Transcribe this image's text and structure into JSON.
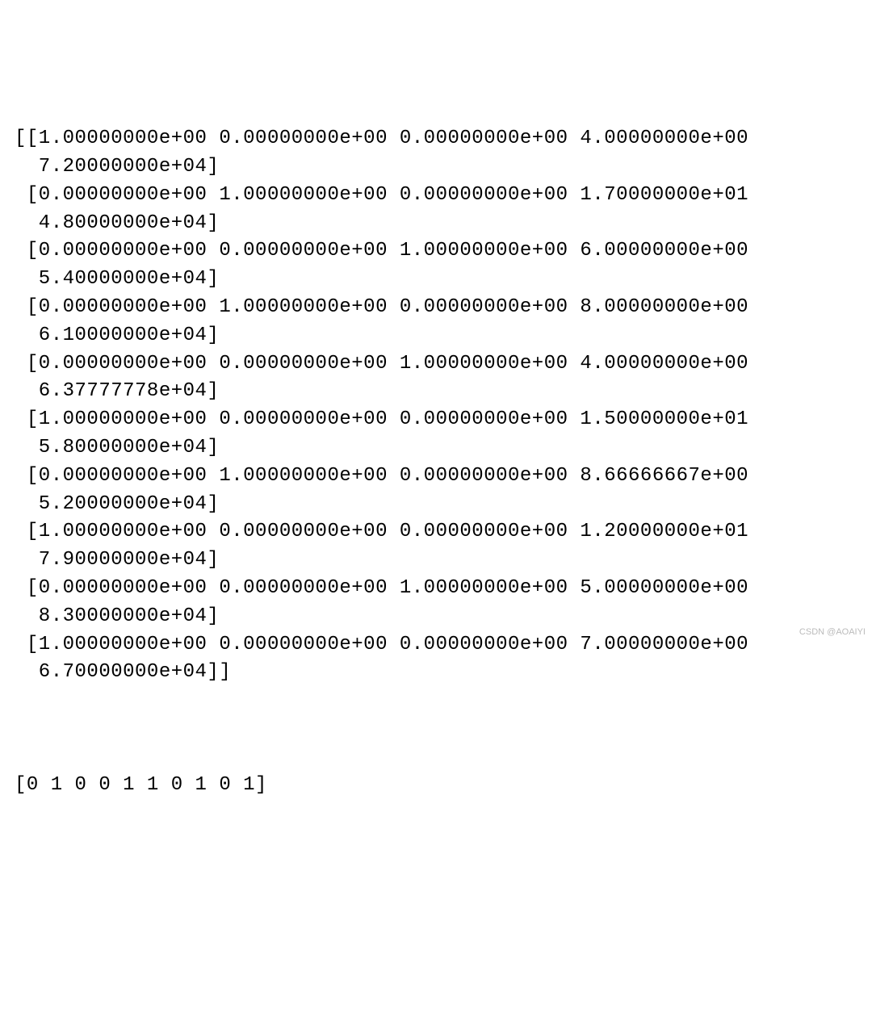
{
  "matrix_text": "[[1.00000000e+00 0.00000000e+00 0.00000000e+00 4.00000000e+00\n  7.20000000e+04]\n [0.00000000e+00 1.00000000e+00 0.00000000e+00 1.70000000e+01\n  4.80000000e+04]\n [0.00000000e+00 0.00000000e+00 1.00000000e+00 6.00000000e+00\n  5.40000000e+04]\n [0.00000000e+00 1.00000000e+00 0.00000000e+00 8.00000000e+00\n  6.10000000e+04]\n [0.00000000e+00 0.00000000e+00 1.00000000e+00 4.00000000e+00\n  6.37777778e+04]\n [1.00000000e+00 0.00000000e+00 0.00000000e+00 1.50000000e+01\n  5.80000000e+04]\n [0.00000000e+00 1.00000000e+00 0.00000000e+00 8.66666667e+00\n  5.20000000e+04]\n [1.00000000e+00 0.00000000e+00 0.00000000e+00 1.20000000e+01\n  7.90000000e+04]\n [0.00000000e+00 0.00000000e+00 1.00000000e+00 5.00000000e+00\n  8.30000000e+04]\n [1.00000000e+00 0.00000000e+00 0.00000000e+00 7.00000000e+00\n  6.70000000e+04]]",
  "array_text": "[0 1 0 0 1 1 0 1 0 1]",
  "watermark": "CSDN @AOAIYI"
}
